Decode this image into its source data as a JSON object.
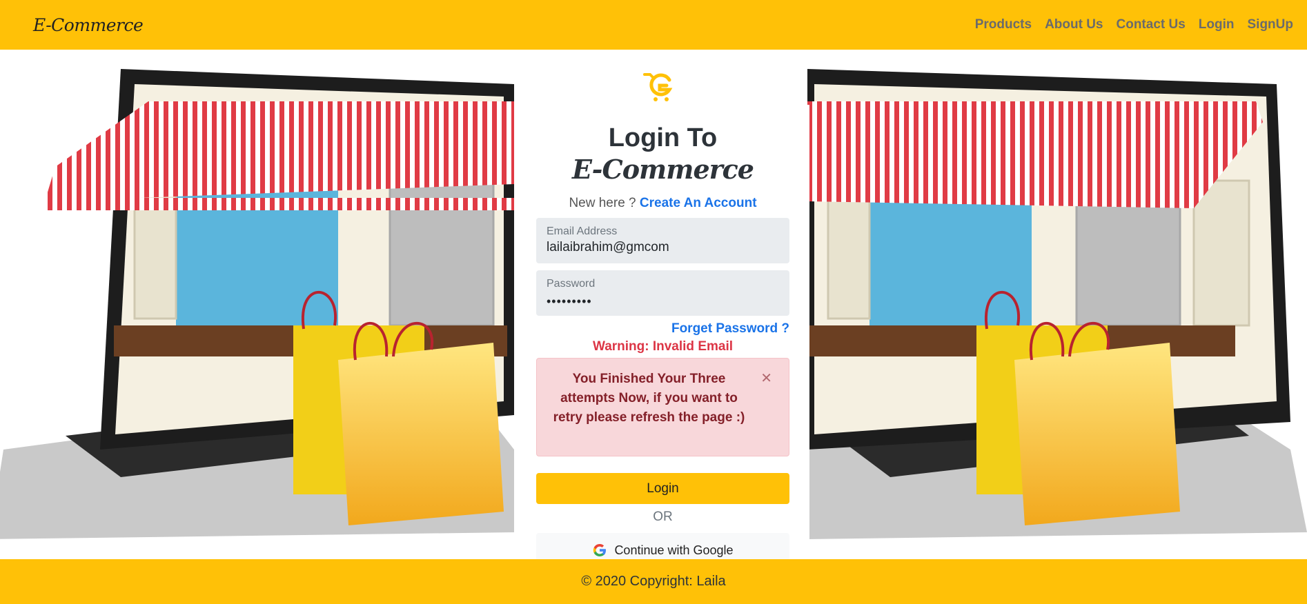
{
  "nav": {
    "brand": "E-Commerce",
    "links": [
      "Products",
      "About Us",
      "Contact Us",
      "Login",
      "SignUp"
    ]
  },
  "login": {
    "title_line1": "Login To",
    "title_line2": "E-Commerce",
    "new_here": "New here ?",
    "create_account": "Create An Account",
    "email_label": "Email Address",
    "email_value": "lailaibrahim@gmcom",
    "password_label": "Password",
    "password_value": "•••••••••",
    "forget_password": "Forget Password ?",
    "warning": "Warning: Invalid Email",
    "alert_text": "You Finished Your Three attempts Now, if you want to retry please refresh the page :)",
    "login_button": "Login",
    "or": "OR",
    "google_button": "Continue with Google"
  },
  "footer": {
    "text": "© 2020 Copyright: Laila"
  },
  "colors": {
    "accent": "#ffc107",
    "link": "#1a73e8",
    "danger": "#dc3545",
    "alert_bg": "#f8d7da"
  }
}
